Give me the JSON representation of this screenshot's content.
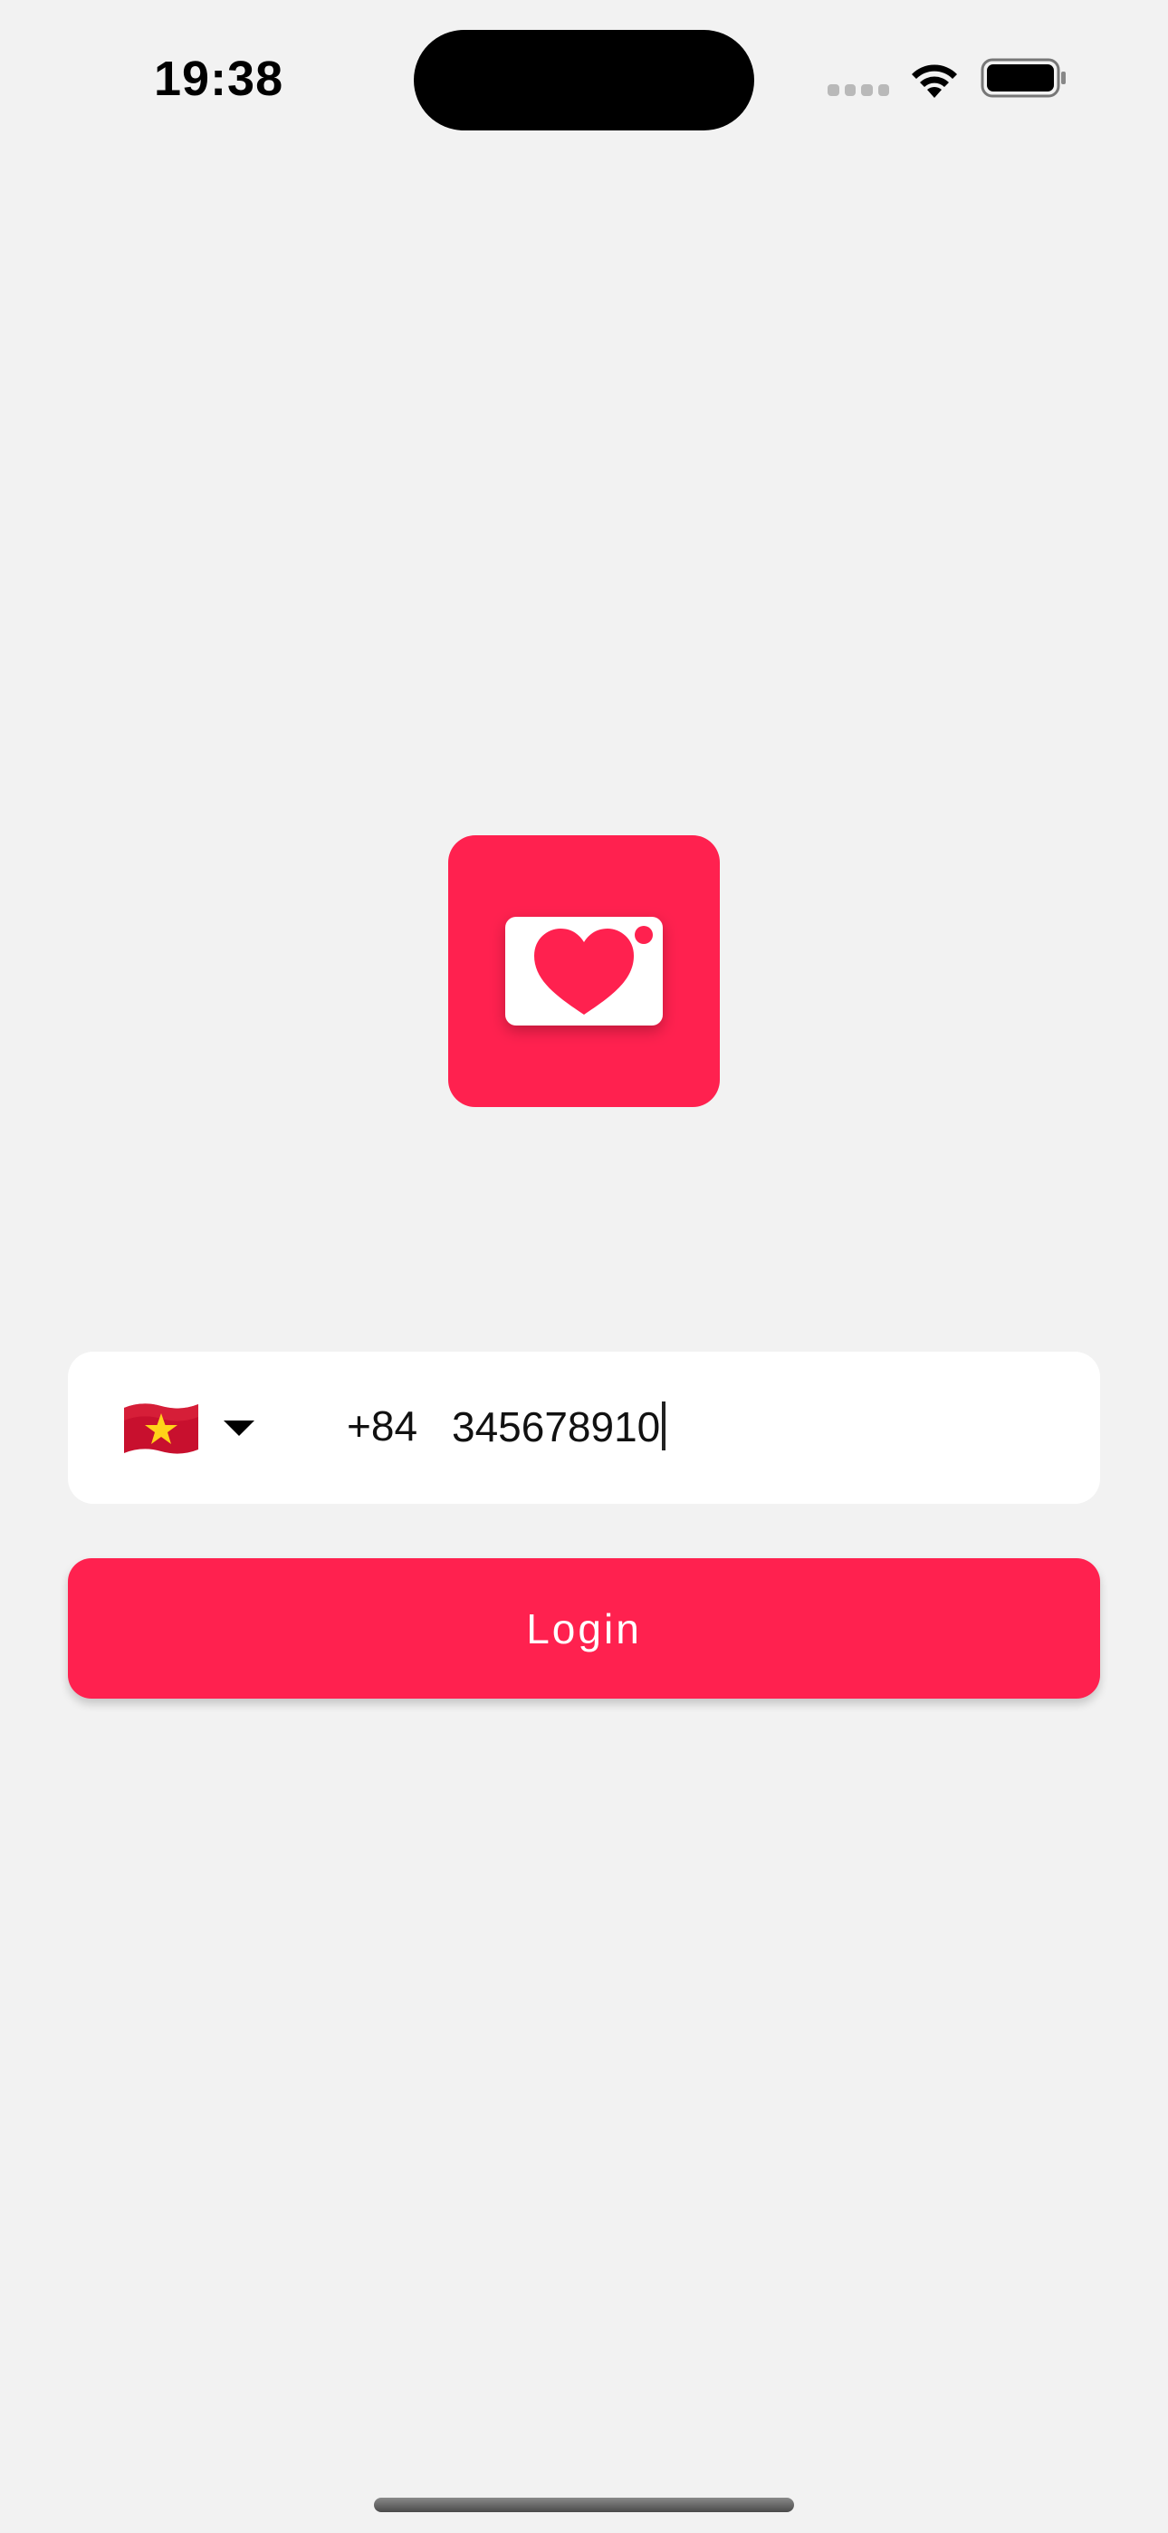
{
  "status_bar": {
    "time": "19:38",
    "signal_icon": "cellular-signal-icon",
    "wifi_icon": "wifi-icon",
    "battery_icon": "battery-icon"
  },
  "logo": {
    "icon": "heart-photo-icon",
    "color": "#ff214f"
  },
  "phone_input": {
    "country_flag_icon": "vietnam-flag-icon",
    "dial_code": "+84",
    "value": "345678910",
    "dropdown_icon": "chevron-down-icon"
  },
  "login_button": {
    "label": "Login",
    "color": "#ff214f"
  }
}
